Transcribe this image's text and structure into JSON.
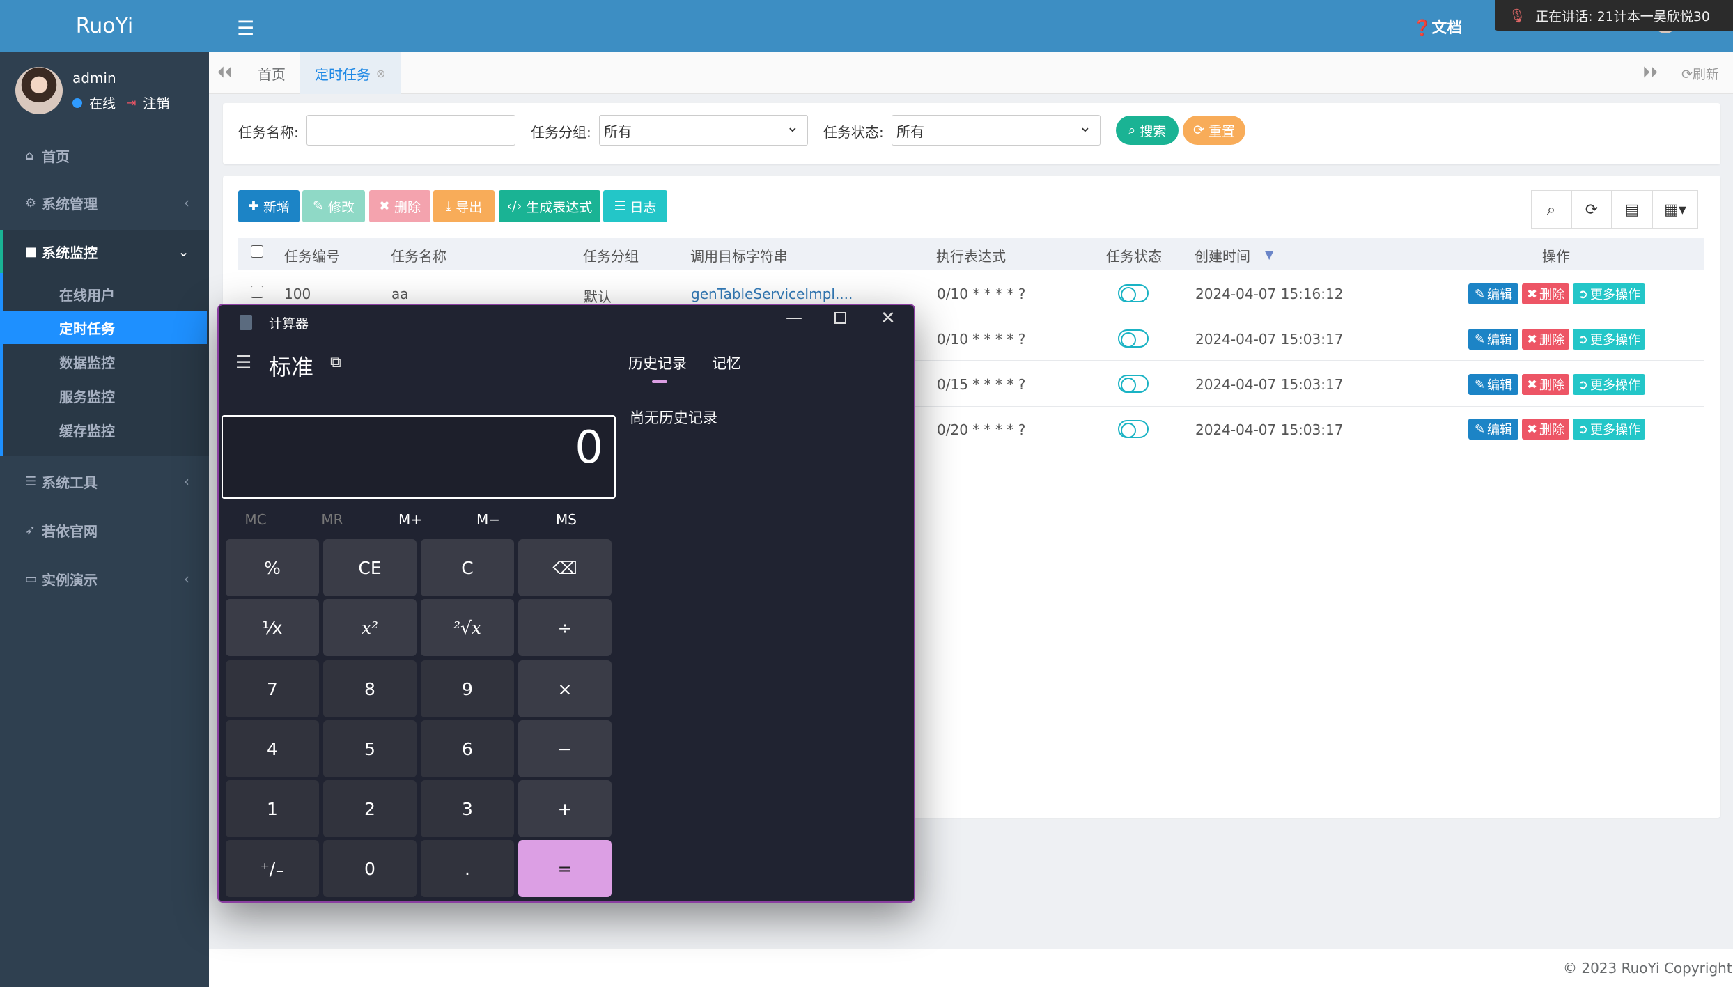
{
  "app": {
    "logo": "RuoYi",
    "docs": "文档",
    "speaking": "正在讲话:  21计本一吴欣悦30"
  },
  "user": {
    "name": "admin",
    "status": "在线",
    "logout": "注销"
  },
  "sidebar": {
    "items": [
      {
        "label": "首页"
      },
      {
        "label": "系统管理"
      },
      {
        "label": "系统监控"
      },
      {
        "label": "系统工具"
      },
      {
        "label": "若依官网"
      },
      {
        "label": "实例演示"
      }
    ],
    "sub": [
      {
        "label": "在线用户"
      },
      {
        "label": "定时任务"
      },
      {
        "label": "数据监控"
      },
      {
        "label": "服务监控"
      },
      {
        "label": "缓存监控"
      }
    ]
  },
  "tabs": [
    {
      "label": "首页"
    },
    {
      "label": "定时任务"
    }
  ],
  "refresh": "刷新",
  "search": {
    "name_label": "任务名称:",
    "name_value": "",
    "group_label": "任务分组:",
    "group_value": "所有",
    "status_label": "任务状态:",
    "status_value": "所有",
    "search_btn": "搜索",
    "reset_btn": "重置"
  },
  "toolbar": {
    "add": "新增",
    "edit": "修改",
    "delete": "删除",
    "export": "导出",
    "cron": "生成表达式",
    "log": "日志"
  },
  "table": {
    "headers": [
      "任务编号",
      "任务名称",
      "任务分组",
      "调用目标字符串",
      "执行表达式",
      "任务状态",
      "创建时间",
      "操作"
    ],
    "rows": [
      {
        "id": "100",
        "name": "aa",
        "group": "默认",
        "target": "genTableServiceImpl....",
        "cron": "0/10 * * * * ?",
        "created": "2024-04-07 15:16:12"
      },
      {
        "id": "",
        "name": "",
        "group": "",
        "target": "",
        "cron": "0/10 * * * * ?",
        "created": "2024-04-07 15:03:17"
      },
      {
        "id": "",
        "name": "",
        "group": "",
        "target": "",
        "cron": "0/15 * * * * ?",
        "created": "2024-04-07 15:03:17"
      },
      {
        "id": "",
        "name": "",
        "group": "",
        "target": "",
        "cron": "0/20 * * * * ?",
        "created": "2024-04-07 15:03:17"
      }
    ],
    "actions": {
      "edit": "编辑",
      "delete": "删除",
      "more": "更多操作"
    }
  },
  "footer": "© 2023 RuoYi Copyright",
  "calculator": {
    "title": "计算器",
    "mode": "标准",
    "tab_history": "历史记录",
    "tab_memory": "记忆",
    "no_history": "尚无历史记录",
    "display": "0",
    "memory": [
      "MC",
      "MR",
      "M+",
      "M−",
      "MS"
    ],
    "keys": [
      "%",
      "CE",
      "C",
      "⌫",
      "¹⁄x",
      "x²",
      "²√x",
      "÷",
      "7",
      "8",
      "9",
      "×",
      "4",
      "5",
      "6",
      "−",
      "1",
      "2",
      "3",
      "+",
      "⁺∕₋",
      "0",
      ".",
      "="
    ]
  },
  "colors": {
    "sidebar": "#2f4050",
    "topbar": "#3d8ec3",
    "active": "#1e90ff",
    "calc_bg": "#202331",
    "equals": "#dc9fe4"
  }
}
